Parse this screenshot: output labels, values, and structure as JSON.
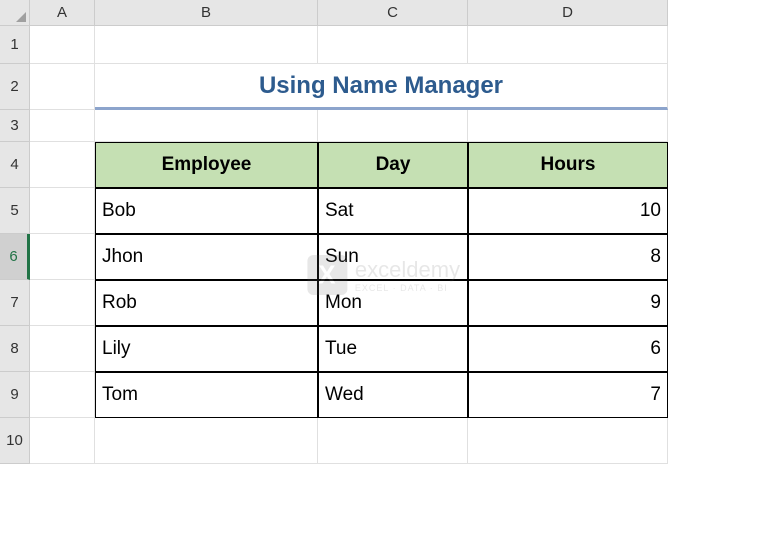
{
  "columns": [
    "A",
    "B",
    "C",
    "D"
  ],
  "rows": [
    "1",
    "2",
    "3",
    "4",
    "5",
    "6",
    "7",
    "8",
    "9",
    "10"
  ],
  "selectedRow": 6,
  "title": "Using Name Manager",
  "tableHeaders": {
    "employee": "Employee",
    "day": "Day",
    "hours": "Hours"
  },
  "tableData": [
    {
      "employee": "Bob",
      "day": "Sat",
      "hours": "10"
    },
    {
      "employee": "Jhon",
      "day": "Sun",
      "hours": "8"
    },
    {
      "employee": "Rob",
      "day": "Mon",
      "hours": "9"
    },
    {
      "employee": "Lily",
      "day": "Tue",
      "hours": "6"
    },
    {
      "employee": "Tom",
      "day": "Wed",
      "hours": "7"
    }
  ],
  "watermark": {
    "title": "exceldemy",
    "subtitle": "EXCEL · DATA · BI"
  }
}
